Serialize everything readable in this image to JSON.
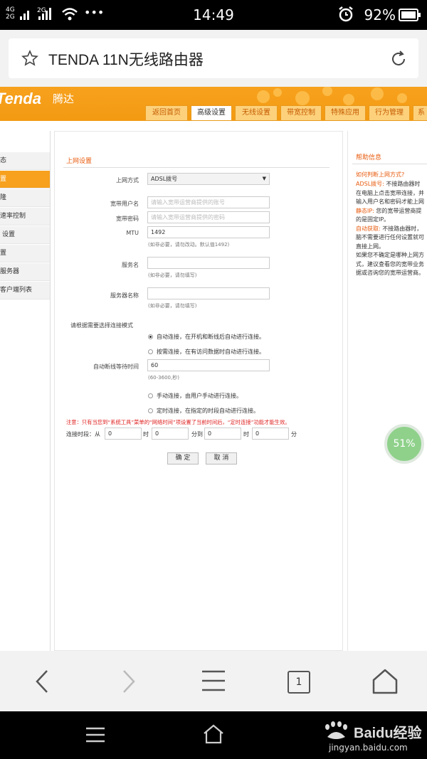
{
  "status_bar": {
    "signal_1": "4G",
    "signal_2": "2G",
    "signal_3": "2G",
    "dots": "•••",
    "time": "14:49",
    "battery": "92%"
  },
  "browser": {
    "title": "TENDA 11N无线路由器"
  },
  "header": {
    "logo": "Tenda",
    "logo_cn": "腾达",
    "tabs": [
      "返回首页",
      "高级设置",
      "无线设置",
      "带宽控制",
      "特殊应用",
      "行为管理",
      "系"
    ]
  },
  "sidebar": {
    "items": [
      "态",
      "置",
      "隆",
      "速率控制",
      "设置",
      "置",
      "服务器",
      "客户端列表"
    ]
  },
  "form": {
    "section_title": "上网设置",
    "mode_label": "上网方式",
    "mode_value": "ADSL拨号",
    "user_label": "宽带用户名",
    "user_placeholder": "请输入宽带运营商提供的账号",
    "pass_label": "宽带密码",
    "pass_placeholder": "请输入宽带运营商提供的密码",
    "mtu_label": "MTU",
    "mtu_value": "1492",
    "mtu_hint": "(如非必要，请勿改动。默认值1492)",
    "service_label": "服务名",
    "service_hint": "(如非必要，请勿填写)",
    "server_label": "服务器名称",
    "server_hint": "(如非必要，请勿填写)",
    "conn_mode_label": "请根据需要选择连接模式",
    "opt_auto": "自动连接，在开机和断线后自动进行连接。",
    "opt_demand": "按需连接，在有访问数据时自动进行连接。",
    "idle_label": "自动断线等待时间",
    "idle_value": "60",
    "idle_hint": "(60-3600,秒)",
    "opt_manual": "手动连接，由用户手动进行连接。",
    "opt_timed": "定时连接，在指定的时段自动进行连接。",
    "notice": "注意：只有当您到“系统工具”菜单的“网络时间”项设置了当前时间后，“定时连接”功能才能生效。",
    "period_label": "连接时段：从",
    "hour1_unit": "时",
    "min1_unit": "分到",
    "hour2_unit": "时",
    "min2_unit": "分",
    "hour1": "0",
    "min1": "0",
    "hour2": "0",
    "min2": "0",
    "ok": "确 定",
    "cancel": "取 消"
  },
  "help": {
    "title": "帮助信息",
    "q": "如何判断上网方式?",
    "lines": [
      {
        "k": "ADSL拨号:",
        "v": " 不接路由器时"
      },
      {
        "k": "",
        "v": "在电脑上点击宽带连接，并"
      },
      {
        "k": "",
        "v": "输入用户名和密码才能上网"
      },
      {
        "k": "静态IP:",
        "v": " 您的宽带运营商提"
      },
      {
        "k": "",
        "v": "的是固定IP。"
      },
      {
        "k": "自动获取:",
        "v": " 不接路由器时，"
      },
      {
        "k": "",
        "v": "脑不需要进行任何设置就可"
      },
      {
        "k": "",
        "v": "直接上网。"
      },
      {
        "k": "",
        "v": "如果您不确定是哪种上网方"
      },
      {
        "k": "",
        "v": "式，建议查看您的宽带业务"
      },
      {
        "k": "",
        "v": "据或咨询您的宽带运营商。"
      }
    ]
  },
  "float_progress": "51%",
  "bottom_nav": {
    "tab_count": "1"
  },
  "watermark": {
    "brand": "Baidu经验",
    "url": "jingyan.baidu.com"
  }
}
